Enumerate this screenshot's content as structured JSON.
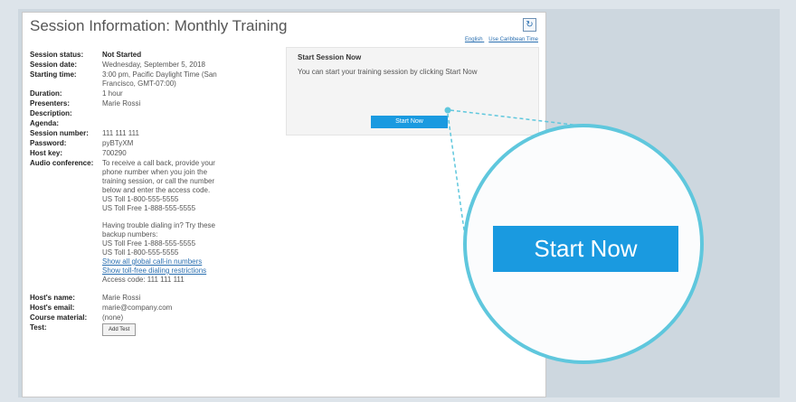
{
  "window": {
    "title": "Session Information: Monthly Training",
    "refresh_icon": "↻",
    "links": [
      "English",
      "Use Caribbean Time"
    ]
  },
  "session_info": {
    "rows": [
      {
        "label": "Session status:",
        "lines": [
          "Not Started"
        ]
      },
      {
        "label": "Session date:",
        "lines": [
          "Wednesday, September 5, 2018"
        ]
      },
      {
        "label": "Starting time:",
        "lines": [
          "3:00 pm, Pacific Daylight Time (San",
          "Francisco, GMT-07:00)"
        ]
      },
      {
        "label": "Duration:",
        "lines": [
          "1 hour"
        ]
      },
      {
        "label": "Presenters:",
        "lines": [
          "Marie Rossi"
        ]
      },
      {
        "label": "Description:",
        "lines": [
          ""
        ]
      },
      {
        "label": "Agenda:",
        "lines": [
          ""
        ]
      },
      {
        "label": "Session number:",
        "lines": [
          "111 111 111"
        ]
      },
      {
        "label": "Password:",
        "lines": [
          "pyBTyXM"
        ]
      },
      {
        "label": "Host key:",
        "lines": [
          "700290"
        ]
      }
    ],
    "audio_label": "Audio conference:",
    "audio_lines": [
      "To receive a call back, provide your",
      "phone number when you join the",
      "training session, or call the number",
      "below and enter the access code.",
      "US Toll 1-800-555-5555",
      "US Toll Free 1-888-555-5555"
    ],
    "trouble_lines": [
      "Having trouble dialing in? Try these",
      "backup numbers:",
      "US Toll Free 1-888-555-5555",
      "US Toll 1-800-555-5555"
    ],
    "links": [
      "Show all global call-in numbers",
      "Show toll-free dialing restrictions"
    ],
    "access_code": "Access code: 111 111 111",
    "host_rows": [
      {
        "label": "Host's name:",
        "value": "Marie Rossi"
      },
      {
        "label": "Host's email:",
        "value": "marie@company.com"
      },
      {
        "label": "Course material:",
        "value": "(none)"
      }
    ],
    "last_label": "Test:",
    "add_button": "Add Test"
  },
  "start_session": {
    "title": "Start Session Now",
    "text": "You can start your training session by clicking Start Now",
    "button_small": "Start Now",
    "button_big": "Start Now"
  },
  "colors": {
    "accent": "#1a9ae0",
    "callout": "#5fc7dd"
  }
}
